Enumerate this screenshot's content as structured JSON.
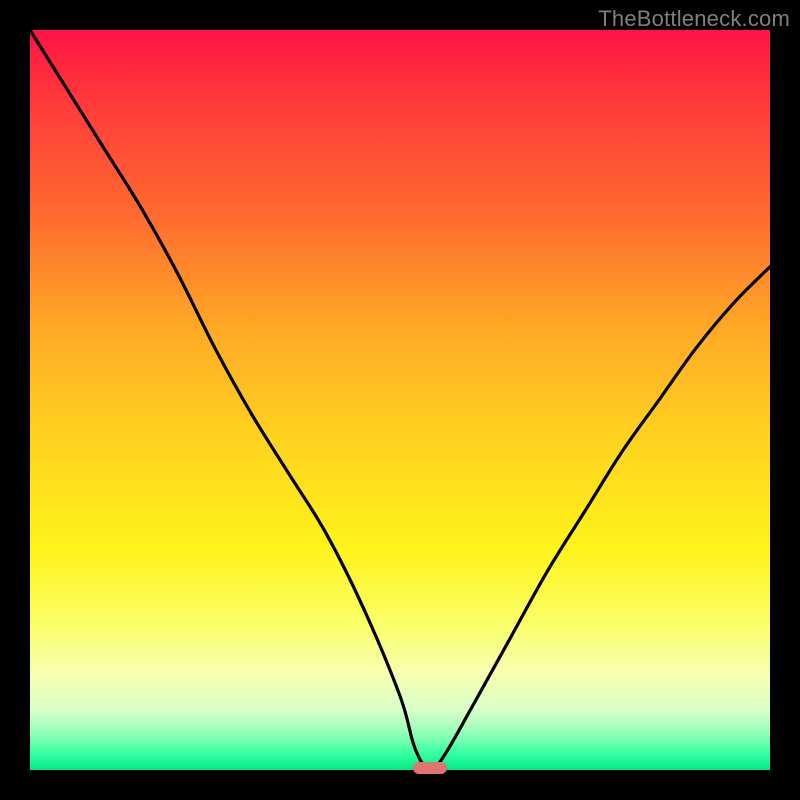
{
  "watermark": "TheBottleneck.com",
  "colors": {
    "frame": "#000000",
    "gradient_top": "#ff1344",
    "gradient_mid": "#fff31a",
    "gradient_bottom": "#00e886",
    "curve": "#000000",
    "marker": "#e2746f",
    "watermark_text": "#7f7f7f"
  },
  "chart_data": {
    "type": "line",
    "title": "",
    "xlabel": "",
    "ylabel": "",
    "xlim": [
      0,
      100
    ],
    "ylim": [
      0,
      100
    ],
    "annotations": [],
    "series": [
      {
        "name": "bottleneck-curve",
        "x": [
          0,
          5,
          10,
          15,
          20,
          25,
          30,
          35,
          40,
          45,
          50,
          52,
          54,
          56,
          60,
          65,
          70,
          75,
          80,
          85,
          90,
          95,
          100
        ],
        "y": [
          100,
          92,
          84,
          76,
          67,
          57,
          48,
          40,
          32,
          22,
          10,
          3,
          0,
          2,
          9,
          18,
          27,
          35,
          43,
          50,
          57,
          63,
          68
        ]
      }
    ],
    "minimum": {
      "x": 54,
      "y": 0
    },
    "grid": false,
    "legend": false
  }
}
